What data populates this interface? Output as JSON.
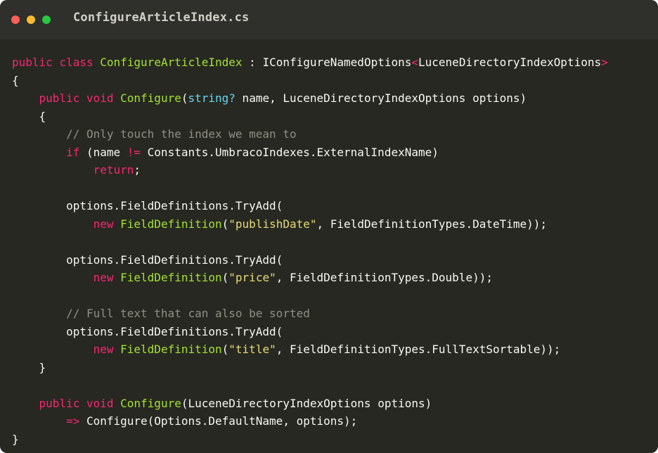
{
  "window": {
    "title": "ConfigureArticleIndex.cs",
    "traffic_lights": [
      {
        "name": "close-dot",
        "color": "#ff5f56"
      },
      {
        "name": "minimize-dot",
        "color": "#ffbd2e"
      },
      {
        "name": "zoom-dot",
        "color": "#27c93f"
      }
    ]
  },
  "colors": {
    "background": "#272822",
    "keyword": "#f92672",
    "type": "#a6e22e",
    "builtin": "#66d9ef",
    "string": "#e6db74",
    "comment": "#8f8f85",
    "plain": "#f8f8f2"
  },
  "code": {
    "language": "C#",
    "lines": [
      [
        [
          "keyword",
          "public"
        ],
        [
          "plain",
          " "
        ],
        [
          "keyword",
          "class"
        ],
        [
          "plain",
          " "
        ],
        [
          "type",
          "ConfigureArticleIndex"
        ],
        [
          "plain",
          " : IConfigureNamedOptions"
        ],
        [
          "keyword",
          "<"
        ],
        [
          "plain",
          "LuceneDirectoryIndexOptions"
        ],
        [
          "keyword",
          ">"
        ]
      ],
      [
        [
          "plain",
          "{"
        ]
      ],
      [
        [
          "plain",
          "    "
        ],
        [
          "keyword",
          "public"
        ],
        [
          "plain",
          " "
        ],
        [
          "keyword",
          "void"
        ],
        [
          "plain",
          " "
        ],
        [
          "type",
          "Configure"
        ],
        [
          "plain",
          "("
        ],
        [
          "builtin",
          "string?"
        ],
        [
          "plain",
          " name, LuceneDirectoryIndexOptions options)"
        ]
      ],
      [
        [
          "plain",
          "    {"
        ]
      ],
      [
        [
          "plain",
          "        "
        ],
        [
          "comment",
          "// Only touch the index we mean to"
        ]
      ],
      [
        [
          "plain",
          "        "
        ],
        [
          "keyword",
          "if"
        ],
        [
          "plain",
          " (name "
        ],
        [
          "keyword",
          "!="
        ],
        [
          "plain",
          " Constants.UmbracoIndexes.ExternalIndexName)"
        ]
      ],
      [
        [
          "plain",
          "            "
        ],
        [
          "keyword",
          "return"
        ],
        [
          "plain",
          ";"
        ]
      ],
      [
        [
          "plain",
          ""
        ]
      ],
      [
        [
          "plain",
          "        options.FieldDefinitions.TryAdd("
        ]
      ],
      [
        [
          "plain",
          "            "
        ],
        [
          "keyword",
          "new"
        ],
        [
          "plain",
          " "
        ],
        [
          "type",
          "FieldDefinition"
        ],
        [
          "plain",
          "("
        ],
        [
          "string",
          "\"publishDate\""
        ],
        [
          "plain",
          ", FieldDefinitionTypes.DateTime));"
        ]
      ],
      [
        [
          "plain",
          ""
        ]
      ],
      [
        [
          "plain",
          "        options.FieldDefinitions.TryAdd("
        ]
      ],
      [
        [
          "plain",
          "            "
        ],
        [
          "keyword",
          "new"
        ],
        [
          "plain",
          " "
        ],
        [
          "type",
          "FieldDefinition"
        ],
        [
          "plain",
          "("
        ],
        [
          "string",
          "\"price\""
        ],
        [
          "plain",
          ", FieldDefinitionTypes.Double));"
        ]
      ],
      [
        [
          "plain",
          ""
        ]
      ],
      [
        [
          "plain",
          "        "
        ],
        [
          "comment",
          "// Full text that can also be sorted"
        ]
      ],
      [
        [
          "plain",
          "        options.FieldDefinitions.TryAdd("
        ]
      ],
      [
        [
          "plain",
          "            "
        ],
        [
          "keyword",
          "new"
        ],
        [
          "plain",
          " "
        ],
        [
          "type",
          "FieldDefinition"
        ],
        [
          "plain",
          "("
        ],
        [
          "string",
          "\"title\""
        ],
        [
          "plain",
          ", FieldDefinitionTypes.FullTextSortable));"
        ]
      ],
      [
        [
          "plain",
          "    }"
        ]
      ],
      [
        [
          "plain",
          ""
        ]
      ],
      [
        [
          "plain",
          "    "
        ],
        [
          "keyword",
          "public"
        ],
        [
          "plain",
          " "
        ],
        [
          "keyword",
          "void"
        ],
        [
          "plain",
          " "
        ],
        [
          "type",
          "Configure"
        ],
        [
          "plain",
          "(LuceneDirectoryIndexOptions options)"
        ]
      ],
      [
        [
          "plain",
          "        "
        ],
        [
          "keyword",
          "=>"
        ],
        [
          "plain",
          " Configure(Options.DefaultName, options);"
        ]
      ],
      [
        [
          "plain",
          "}"
        ]
      ]
    ]
  }
}
